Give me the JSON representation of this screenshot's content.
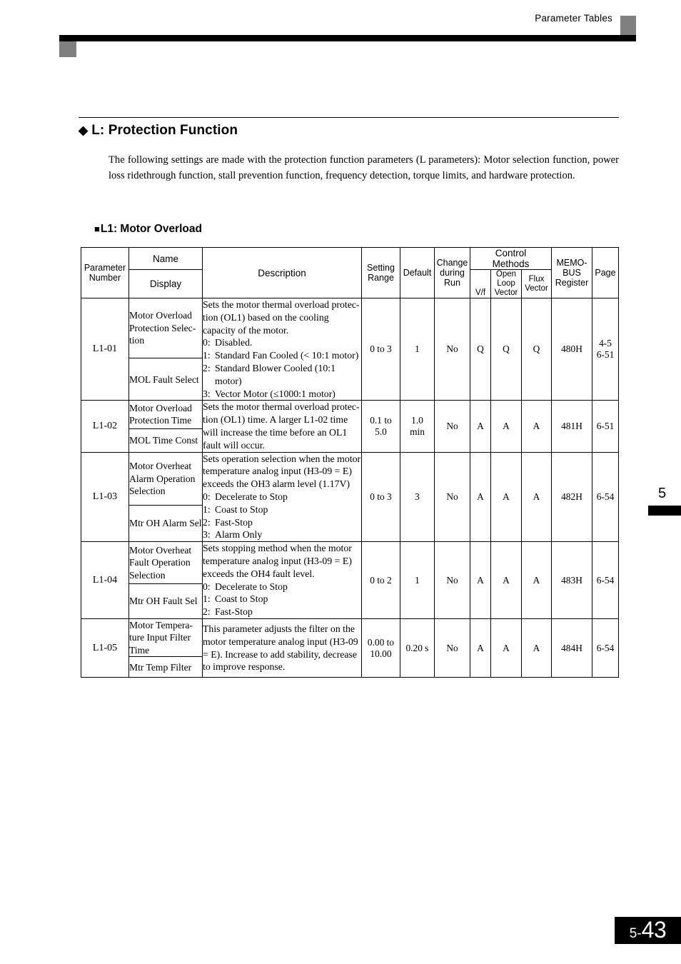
{
  "header": {
    "running_title": "Parameter Tables"
  },
  "section": {
    "bullet": "◆",
    "title": "L: Protection Function",
    "intro": "The following settings are made with the protection function parameters (L parameters): Motor selection function, power loss ridethrough function, stall prevention function, frequency detection, torque limits, and hardware protection."
  },
  "subsection": {
    "bullet": "■",
    "title": "L1: Motor Overload"
  },
  "table": {
    "headers": {
      "parameter_number": "Parameter\nNumber",
      "name": "Name",
      "display": "Display",
      "description": "Description",
      "setting_range": "Setting\nRange",
      "default": "Default",
      "change_during_run": "Change\nduring\nRun",
      "control_methods": "Control\nMethods",
      "vf": "V/f",
      "open_loop_vector": "Open\nLoop\nVector",
      "flux_vector": "Flux\nVector",
      "memobus_register": "MEMO-\nBUS\nRegister",
      "page": "Page"
    },
    "rows": [
      {
        "number": "L1-01",
        "name": "Motor Overload Protection Selec-tion",
        "display": "MOL Fault Select",
        "desc_intro": "Sets the motor thermal overload protec-tion (OL1) based on the cooling capacity of the motor.",
        "desc_items": [
          {
            "key": "0:",
            "value": "Disabled."
          },
          {
            "key": "1:",
            "value": "Standard Fan Cooled (< 10:1 motor)"
          },
          {
            "key": "2:",
            "value": "Standard Blower Cooled (10:1 motor)"
          },
          {
            "key": "3:",
            "value": "Vector Motor (≤1000:1 motor)"
          }
        ],
        "setting_range": "0 to 3",
        "default": "1",
        "change_during_run": "No",
        "vf": "Q",
        "open_loop_vector": "Q",
        "flux_vector": "Q",
        "memobus_register": "480H",
        "page": "4-5\n6-51"
      },
      {
        "number": "L1-02",
        "name": "Motor Overload Protection Time",
        "display": "MOL Time Const",
        "desc_intro": "Sets the motor thermal overload protec-tion (OL1) time. A larger L1-02 time will increase the time before an OL1 fault will occur.",
        "desc_items": [],
        "setting_range": "0.1 to\n5.0",
        "default": "1.0\nmin",
        "change_during_run": "No",
        "vf": "A",
        "open_loop_vector": "A",
        "flux_vector": "A",
        "memobus_register": "481H",
        "page": "6-51"
      },
      {
        "number": "L1-03",
        "name": "Motor Overheat Alarm Operation Selection",
        "display": "Mtr OH Alarm Sel",
        "desc_intro": "Sets operation selection when the motor temperature analog input (H3-09 = E) exceeds the OH3 alarm level (1.17V)",
        "desc_items": [
          {
            "key": "0:",
            "value": "Decelerate to Stop"
          },
          {
            "key": "1:",
            "value": "Coast to Stop"
          },
          {
            "key": "2:",
            "value": "Fast-Stop"
          },
          {
            "key": "3:",
            "value": "Alarm Only"
          }
        ],
        "setting_range": "0 to 3",
        "default": "3",
        "change_during_run": "No",
        "vf": "A",
        "open_loop_vector": "A",
        "flux_vector": "A",
        "memobus_register": "482H",
        "page": "6-54"
      },
      {
        "number": "L1-04",
        "name": "Motor Overheat Fault Operation Selection",
        "display": "Mtr OH Fault Sel",
        "desc_intro": "Sets stopping method when the motor temperature analog input (H3-09 = E) exceeds the OH4 fault level.",
        "desc_items": [
          {
            "key": "0:",
            "value": "Decelerate to Stop"
          },
          {
            "key": "1:",
            "value": "Coast to Stop"
          },
          {
            "key": "2:",
            "value": "Fast-Stop"
          }
        ],
        "setting_range": "0 to 2",
        "default": "1",
        "change_during_run": "No",
        "vf": "A",
        "open_loop_vector": "A",
        "flux_vector": "A",
        "memobus_register": "483H",
        "page": "6-54"
      },
      {
        "number": "L1-05",
        "name": "Motor Tempera-ture Input Filter Time",
        "display": "Mtr Temp Filter",
        "desc_intro": "This parameter adjusts the filter on the motor temperature analog input (H3-09 = E). Increase to add stability, decrease to improve response.",
        "desc_items": [],
        "setting_range": "0.00 to\n10.00",
        "default": "0.20 s",
        "change_during_run": "No",
        "vf": "A",
        "open_loop_vector": "A",
        "flux_vector": "A",
        "memobus_register": "484H",
        "page": "6-54"
      }
    ]
  },
  "side_tab": {
    "chapter": "5"
  },
  "folio": {
    "section": "5-",
    "page": "43"
  }
}
